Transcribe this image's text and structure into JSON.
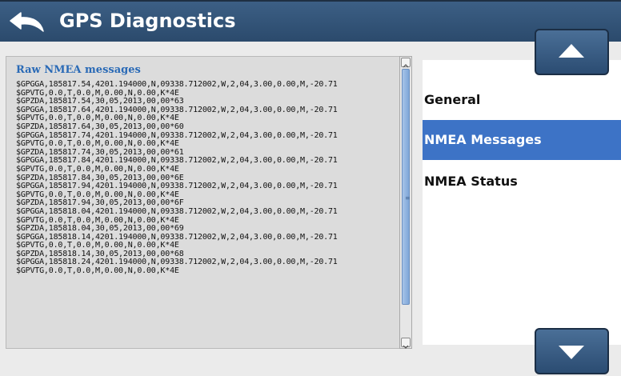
{
  "header": {
    "title": "GPS Diagnostics",
    "back_icon": "back-arrow-icon"
  },
  "nmea_panel": {
    "title": "Raw NMEA messages",
    "lines": [
      "$GPGGA,185817.54,4201.194000,N,09338.712002,W,2,04,3.00,0.00,M,-20.71",
      "$GPVTG,0.0,T,0.0,M,0.00,N,0.00,K*4E",
      "$GPZDA,185817.54,30,05,2013,00,00*63",
      "$GPGGA,185817.64,4201.194000,N,09338.712002,W,2,04,3.00,0.00,M,-20.71",
      "$GPVTG,0.0,T,0.0,M,0.00,N,0.00,K*4E",
      "$GPZDA,185817.64,30,05,2013,00,00*60",
      "$GPGGA,185817.74,4201.194000,N,09338.712002,W,2,04,3.00,0.00,M,-20.71",
      "$GPVTG,0.0,T,0.0,M,0.00,N,0.00,K*4E",
      "$GPZDA,185817.74,30,05,2013,00,00*61",
      "$GPGGA,185817.84,4201.194000,N,09338.712002,W,2,04,3.00,0.00,M,-20.71",
      "$GPVTG,0.0,T,0.0,M,0.00,N,0.00,K*4E",
      "$GPZDA,185817.84,30,05,2013,00,00*6E",
      "$GPGGA,185817.94,4201.194000,N,09338.712002,W,2,04,3.00,0.00,M,-20.71",
      "$GPVTG,0.0,T,0.0,M,0.00,N,0.00,K*4E",
      "$GPZDA,185817.94,30,05,2013,00,00*6F",
      "$GPGGA,185818.04,4201.194000,N,09338.712002,W,2,04,3.00,0.00,M,-20.71",
      "$GPVTG,0.0,T,0.0,M,0.00,N,0.00,K*4E",
      "$GPZDA,185818.04,30,05,2013,00,00*69",
      "$GPGGA,185818.14,4201.194000,N,09338.712002,W,2,04,3.00,0.00,M,-20.71",
      "$GPVTG,0.0,T,0.0,M,0.00,N,0.00,K*4E",
      "$GPZDA,185818.14,30,05,2013,00,00*68",
      "$GPGGA,185818.24,4201.194000,N,09338.712002,W,2,04,3.00,0.00,M,-20.71",
      "$GPVTG,0.0,T,0.0,M,0.00,N,0.00,K*4E"
    ]
  },
  "menu": {
    "items": [
      {
        "label": "General",
        "active": false
      },
      {
        "label": "NMEA Messages",
        "active": true
      },
      {
        "label": "NMEA Status",
        "active": false
      }
    ]
  },
  "buttons": {
    "up_icon": "up-arrow-icon",
    "down_icon": "down-arrow-icon"
  },
  "colors": {
    "header": "#2e4d70",
    "selected": "#3d73c6",
    "panel_title": "#2a6ab6"
  }
}
